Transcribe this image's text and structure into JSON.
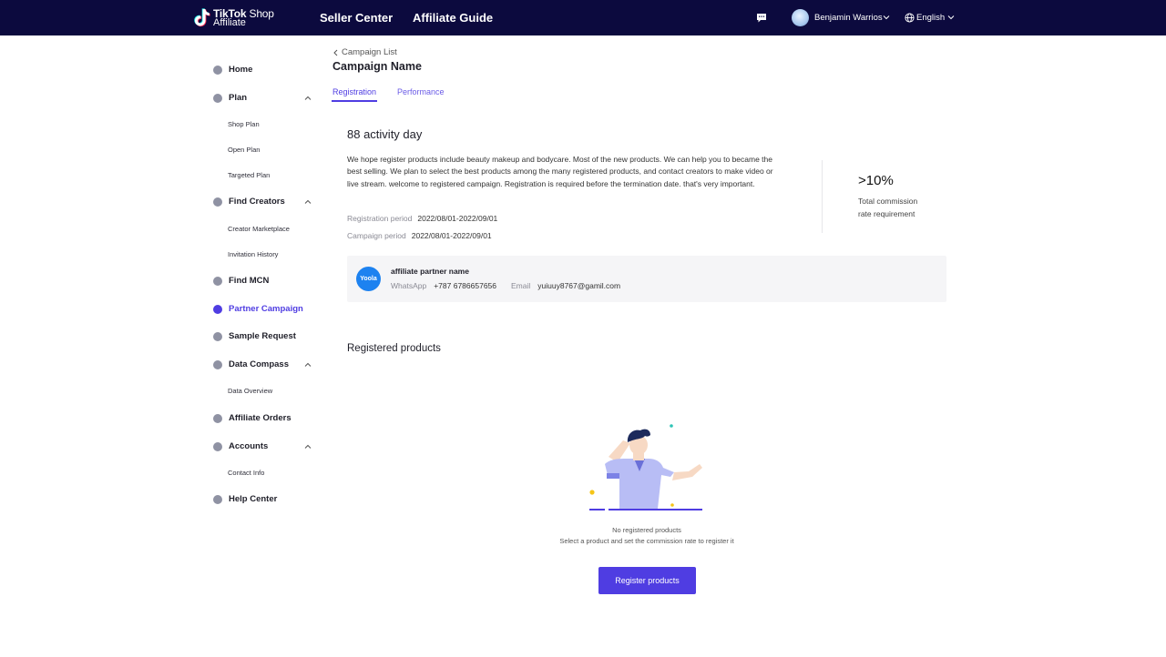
{
  "header": {
    "logo_brand": "TikTok",
    "logo_shop": "Shop",
    "logo_affiliate": "Affiliate",
    "nav": [
      "Seller Center",
      "Affiliate Guide"
    ],
    "user_name": "Benjamin Warrios",
    "language": "English",
    "icons": [
      "message-icon",
      "avatar",
      "globe-icon",
      "chevron-down-icon"
    ]
  },
  "sidebar": {
    "items": [
      {
        "label": "Home",
        "icon": "home-icon"
      },
      {
        "label": "Plan",
        "icon": "plan-icon",
        "expanded": true,
        "children": [
          "Shop Plan",
          "Open Plan",
          "Targeted Plan"
        ]
      },
      {
        "label": "Find Creators",
        "icon": "creators-icon",
        "expanded": true,
        "children": [
          "Creator Marketplace",
          "Invitation History"
        ]
      },
      {
        "label": "Find MCN",
        "icon": "mcn-icon"
      },
      {
        "label": "Partner Campaign",
        "icon": "campaign-icon",
        "active": true
      },
      {
        "label": "Sample Request",
        "icon": "sample-icon"
      },
      {
        "label": "Data Compass",
        "icon": "compass-icon",
        "expanded": true,
        "children": [
          "Data Overview"
        ]
      },
      {
        "label": "Affiliate Orders",
        "icon": "orders-icon"
      },
      {
        "label": "Accounts",
        "icon": "accounts-icon",
        "expanded": true,
        "children": [
          "Contact Info"
        ]
      },
      {
        "label": "Help Center",
        "icon": "help-icon"
      }
    ]
  },
  "main": {
    "breadcrumb": "Campaign List",
    "title": "Campaign Name",
    "tabs": [
      {
        "label": "Registration",
        "active": true
      },
      {
        "label": "Performance",
        "active": false
      }
    ],
    "activity": {
      "title": "88 activity day",
      "description": "We hope register products include beauty makeup and bodycare. Most of the new products. We can help you to became the best selling. We plan to select the best products among the many registered products, and contact creators to make video or live stream. welcome to registered campaign.  Registration is required before the termination date. that's very important.",
      "registration_period_label": "Registration period",
      "registration_period": "2022/08/01-2022/09/01",
      "campaign_period_label": "Campaign period",
      "campaign_period": "2022/08/01-2022/09/01",
      "commission_value": ">10%",
      "commission_label": "Total commission rate requirement"
    },
    "partner": {
      "logo_text": "Yoola",
      "name": "affiliate partner name",
      "whatsapp_label": "WhatsApp",
      "whatsapp": "+787 6786657656",
      "email_label": "Email",
      "email": "yuiuuy8767@gamil.com"
    },
    "registered": {
      "title": "Registered products",
      "empty_title": "No registered products",
      "empty_hint": "Select a product and set the commission rate to register it",
      "button": "Register products"
    }
  },
  "colors": {
    "header_bg": "#0c0a3e",
    "accent": "#4f3de2",
    "partner_logo": "#1d82f0",
    "card_bg": "#f5f5f7"
  }
}
